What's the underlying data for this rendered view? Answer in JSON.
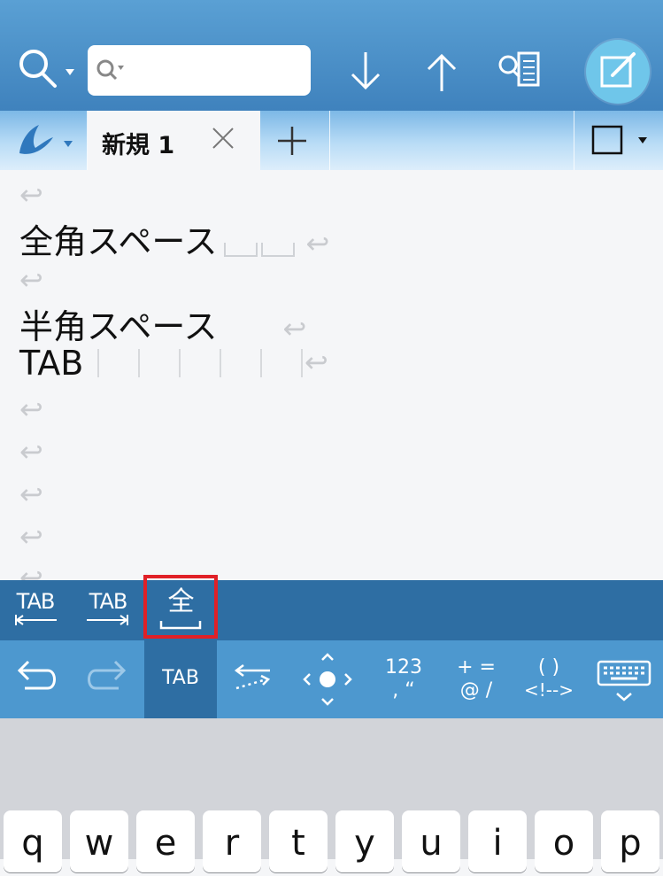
{
  "search": {
    "placeholder": "",
    "value": ""
  },
  "tab": {
    "label": "新規 1"
  },
  "editor": {
    "lines": [
      "全角スペース",
      "半角スペース",
      "TAB"
    ],
    "return_mark": "↩"
  },
  "special_bar": {
    "tab_left_label": "TAB",
    "tab_right_label": "TAB",
    "fullwidth_label": "全"
  },
  "accessory": {
    "tab_label": "TAB",
    "numbers_top": "123",
    "numbers_bottom": ", “",
    "symbols_top": "+ =",
    "symbols_bottom": "@ /",
    "brackets_top": "(   )",
    "brackets_bottom": "<!-->"
  },
  "keyboard": {
    "keys": [
      "q",
      "w",
      "e",
      "r",
      "t",
      "y",
      "u",
      "i",
      "o",
      "p"
    ]
  },
  "colors": {
    "toolbar": "#4a90c8",
    "special_bar": "#2e6ea3",
    "accessory_bar": "#4d98cf",
    "highlight": "#e02027",
    "edit_button": "#6fc6ea"
  }
}
